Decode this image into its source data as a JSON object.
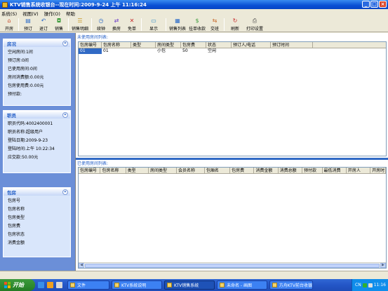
{
  "window": {
    "title": "KTV销售系统收银台--现在时间:2009-9-24 上午 11:16:24"
  },
  "menu": [
    "系统(S)",
    "视图(V)",
    "操作(O)",
    "帮助"
  ],
  "toolbar": [
    {
      "label": "开房",
      "icon": "house-icon",
      "color": "#c84a2a"
    },
    {
      "label": "预订",
      "icon": "book-icon",
      "color": "#2a6ac8"
    },
    {
      "label": "退订",
      "icon": "undo-icon",
      "color": "#2a6ac8"
    },
    {
      "label": "销售",
      "icon": "cart-icon",
      "color": "#3a9a3a"
    },
    {
      "label": "销售明细",
      "icon": "list-icon",
      "color": "#c89a2a"
    },
    {
      "label": "续钟",
      "icon": "clock-icon",
      "color": "#2a6ac8"
    },
    {
      "label": "换房",
      "icon": "swap-icon",
      "color": "#6a3ac8"
    },
    {
      "label": "免单",
      "icon": "free-icon",
      "color": "#c82a2a"
    },
    {
      "label": "显示",
      "icon": "monitor-icon",
      "color": "#2a8ac8"
    },
    {
      "label": "销售列表",
      "icon": "table-icon",
      "color": "#2a6ac8"
    },
    {
      "label": "挂单收款",
      "icon": "money-icon",
      "color": "#3a9a3a"
    },
    {
      "label": "交班",
      "icon": "handover-icon",
      "color": "#c86a2a"
    },
    {
      "label": "刷新",
      "icon": "refresh-icon",
      "color": "#c82a2a"
    },
    {
      "label": "打印设置",
      "icon": "printer-icon",
      "color": "#4a4a4a"
    }
  ],
  "sidebar": {
    "room_info": {
      "title": "房况",
      "items": [
        "空闲房间:1间",
        "预订房:0间",
        "已使用房间:0间",
        "房间消费额:0.00元",
        "包房使用费:0.00元",
        "预付款:"
      ]
    },
    "staff": {
      "title": "职员",
      "items": [
        "职员代码:4002400001",
        "职员名称:超级用户",
        "登陆日期:2009-9-23",
        "登陆时间:上午 10:22:34",
        "应交款:50.00元"
      ]
    },
    "room": {
      "title": "包房",
      "items": [
        "包房号",
        "包房名称",
        "包房类型",
        "包房费",
        "包房状态",
        "消费金额"
      ]
    }
  },
  "unused_rooms": {
    "title": "未使用房间列表:",
    "columns": [
      "包房编号",
      "包房名称",
      "类型",
      "房间类型",
      "包房费",
      "状态",
      "预订人/电话",
      "预订时间"
    ],
    "rows": [
      [
        "01",
        "01",
        "",
        "小包",
        "50",
        "空闲",
        "",
        ""
      ]
    ]
  },
  "used_rooms": {
    "title": "已使用房间列表:",
    "columns": [
      "包房编号",
      "包房名称",
      "类型",
      "房间类型",
      "会员名称",
      "包厢名",
      "包房费",
      "消费金额",
      "消费总额",
      "预付款",
      "最低消费",
      "开房人",
      "开房时"
    ]
  },
  "taskbar": {
    "start": "开始",
    "tasks": [
      {
        "label": "文件",
        "active": false
      },
      {
        "label": "KTV系统说明",
        "active": false
      },
      {
        "label": "KTV销售系统",
        "active": true
      },
      {
        "label": "未命名 - 画图",
        "active": false
      },
      {
        "label": "方舟KTV前台收银",
        "active": false
      }
    ],
    "lang": "CN",
    "clock": "11:16"
  }
}
